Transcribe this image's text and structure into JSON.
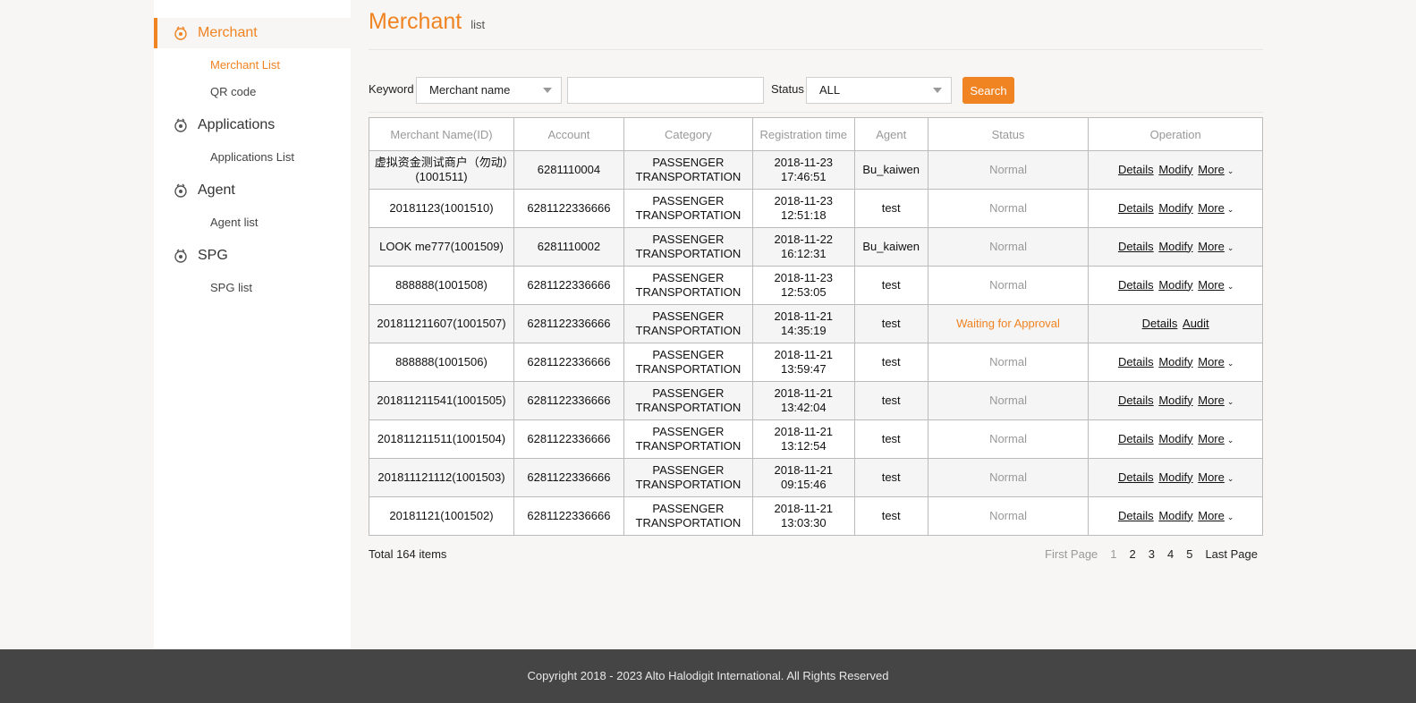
{
  "sidebar": {
    "groups": [
      {
        "label": "Merchant",
        "items": [
          {
            "label": "Merchant List"
          },
          {
            "label": "QR code"
          }
        ]
      },
      {
        "label": "Applications",
        "items": [
          {
            "label": "Applications List"
          }
        ]
      },
      {
        "label": "Agent",
        "items": [
          {
            "label": "Agent list"
          }
        ]
      },
      {
        "label": "SPG",
        "items": [
          {
            "label": "SPG list"
          }
        ]
      }
    ]
  },
  "header": {
    "title": "Merchant",
    "subtitle": "list"
  },
  "filter": {
    "keyword_label": "Keyword",
    "keyword_select": "Merchant name",
    "keyword_value": "",
    "status_label": "Status",
    "status_select": "ALL",
    "search_label": "Search"
  },
  "table": {
    "columns": [
      "Merchant Name(ID)",
      "Account",
      "Category",
      "Registration time",
      "Agent",
      "Status",
      "Operation"
    ],
    "rows": [
      {
        "name": "虚拟资金测试商户（勿动）(1001511)",
        "account": "6281110004",
        "category": "PASSENGER TRANSPORTATION",
        "time": "2018-11-23 17:46:51",
        "agent": "Bu_kaiwen",
        "status": "Normal"
      },
      {
        "name": "20181123(1001510)",
        "account": "6281122336666",
        "category": "PASSENGER TRANSPORTATION",
        "time": "2018-11-23 12:51:18",
        "agent": "test",
        "status": "Normal"
      },
      {
        "name": "LOOK me777(1001509)",
        "account": "6281110002",
        "category": "PASSENGER TRANSPORTATION",
        "time": "2018-11-22 16:12:31",
        "agent": "Bu_kaiwen",
        "status": "Normal"
      },
      {
        "name": "888888(1001508)",
        "account": "6281122336666",
        "category": "PASSENGER TRANSPORTATION",
        "time": "2018-11-23 12:53:05",
        "agent": "test",
        "status": "Normal"
      },
      {
        "name": "201811211607(1001507)",
        "account": "6281122336666",
        "category": "PASSENGER TRANSPORTATION",
        "time": "2018-11-21 14:35:19",
        "agent": "test",
        "status": "Waiting for Approval"
      },
      {
        "name": "888888(1001506)",
        "account": "6281122336666",
        "category": "PASSENGER TRANSPORTATION",
        "time": "2018-11-21 13:59:47",
        "agent": "test",
        "status": "Normal"
      },
      {
        "name": "201811211541(1001505)",
        "account": "6281122336666",
        "category": "PASSENGER TRANSPORTATION",
        "time": "2018-11-21 13:42:04",
        "agent": "test",
        "status": "Normal"
      },
      {
        "name": "201811211511(1001504)",
        "account": "6281122336666",
        "category": "PASSENGER TRANSPORTATION",
        "time": "2018-11-21 13:12:54",
        "agent": "test",
        "status": "Normal"
      },
      {
        "name": "201811121112(1001503)",
        "account": "6281122336666",
        "category": "PASSENGER TRANSPORTATION",
        "time": "2018-11-21 09:15:46",
        "agent": "test",
        "status": "Normal"
      },
      {
        "name": "20181121(1001502)",
        "account": "6281122336666",
        "category": "PASSENGER TRANSPORTATION",
        "time": "2018-11-21 13:03:30",
        "agent": "test",
        "status": "Normal"
      }
    ],
    "ops": {
      "details": "Details",
      "modify": "Modify",
      "more": "More",
      "audit": "Audit"
    }
  },
  "pagination": {
    "total": "Total 164 items",
    "first": "First Page",
    "pages": [
      "1",
      "2",
      "3",
      "4",
      "5"
    ],
    "current": "1",
    "last": "Last Page"
  },
  "footer": {
    "copyright": "Copyright 2018 - 2023 Alto Halodigit International. All Rights Reserved"
  },
  "colors": {
    "accent": "#f08322",
    "footer_bg": "#454545"
  }
}
